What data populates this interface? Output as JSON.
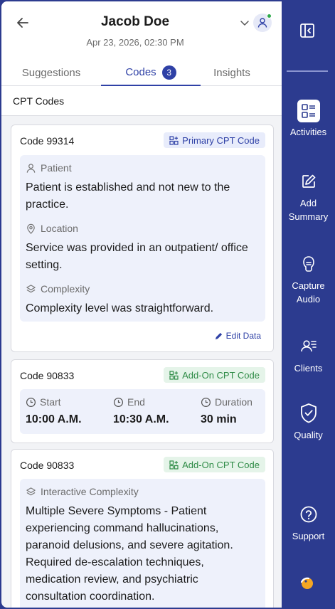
{
  "header": {
    "patient_name": "Jacob Doe",
    "visit_datetime": "Apr 23, 2026, 02:30 PM"
  },
  "tabs": {
    "suggestions": "Suggestions",
    "codes": "Codes",
    "codes_count": "3",
    "insights": "Insights"
  },
  "section_title": "CPT Codes",
  "cards": [
    {
      "code": "Code 99314",
      "tag": "Primary CPT Code",
      "fields": [
        {
          "label": "Patient",
          "value": "Patient is established and not new to the practice."
        },
        {
          "label": "Location",
          "value": "Service was provided in an outpatient/ office  setting."
        },
        {
          "label": "Complexity",
          "value": "Complexity level was straightforward."
        }
      ],
      "edit_label": "Edit Data"
    },
    {
      "code": "Code 90833",
      "tag": "Add-On CPT Code",
      "times": [
        {
          "label": "Start",
          "value": "10:00 A.M."
        },
        {
          "label": "End",
          "value": "10:30 A.M."
        },
        {
          "label": "Duration",
          "value": "30 min"
        }
      ]
    },
    {
      "code": "Code 90833",
      "tag": "Add-On CPT Code",
      "fields": [
        {
          "label": "Interactive Complexity",
          "value": "Multiple Severe Symptoms - Patient experiencing command hallucinations, paranoid delusions, and severe agitation. Required de-escalation techniques, medication review, and psychiatric consultation coordination."
        }
      ]
    }
  ],
  "sidebar": {
    "items": [
      {
        "label": "Activities",
        "icon": "activities-icon"
      },
      {
        "label": "Add Summary",
        "icon": "edit-icon"
      },
      {
        "label": "Capture Audio",
        "icon": "microphone-icon"
      },
      {
        "label": "Clients",
        "icon": "clients-icon"
      },
      {
        "label": "Quality",
        "icon": "shield-check-icon"
      },
      {
        "label": "Support",
        "icon": "question-icon"
      }
    ]
  },
  "colors": {
    "brand": "#2c3b8f",
    "accent": "#2f41a6",
    "addon_green": "#2e8b46",
    "status_online": "#2eaa4a"
  }
}
